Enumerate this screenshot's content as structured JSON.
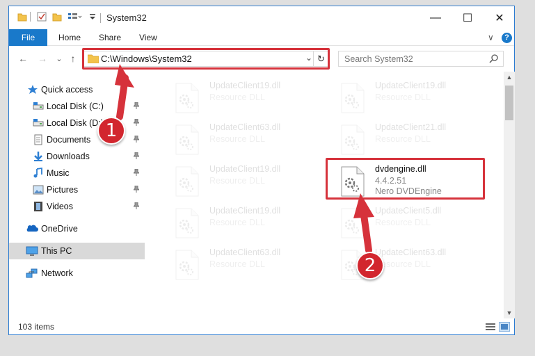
{
  "window": {
    "title": "System32",
    "minimize_glyph": "—",
    "maximize_glyph": "☐",
    "close_glyph": "✕"
  },
  "ribbon": {
    "tabs": [
      "File",
      "Home",
      "Share",
      "View"
    ],
    "expand_glyph": "∨",
    "help_glyph": "?"
  },
  "nav": {
    "back_glyph": "←",
    "forward_glyph": "→",
    "recent_glyph": "⌄",
    "up_glyph": "↑",
    "address": "C:\\Windows\\System32",
    "address_dropdown_glyph": "⌄",
    "refresh_glyph": "↻",
    "search_placeholder": "Search System32"
  },
  "sidebar": {
    "items": [
      {
        "label": "Quick access",
        "icon": "star-icon",
        "pinned": false
      },
      {
        "label": "Local Disk (C:)",
        "icon": "drive-icon",
        "pinned": true
      },
      {
        "label": "Local Disk (D:)",
        "icon": "drive-icon",
        "pinned": true
      },
      {
        "label": "Documents",
        "icon": "documents-icon",
        "pinned": true
      },
      {
        "label": "Downloads",
        "icon": "downloads-icon",
        "pinned": true
      },
      {
        "label": "Music",
        "icon": "music-icon",
        "pinned": true
      },
      {
        "label": "Pictures",
        "icon": "pictures-icon",
        "pinned": true
      },
      {
        "label": "Videos",
        "icon": "videos-icon",
        "pinned": true
      },
      {
        "label": "OneDrive",
        "icon": "onedrive-icon",
        "pinned": false
      },
      {
        "label": "This PC",
        "icon": "pc-icon",
        "pinned": false,
        "selected": true
      },
      {
        "label": "Network",
        "icon": "network-icon",
        "pinned": false
      }
    ],
    "pin_glyph": "📌"
  },
  "files": [
    {
      "name": "UpdateClient19.dll",
      "desc": "Resource DLL"
    },
    {
      "name": "UpdateClient19.dll",
      "desc": "Resource DLL"
    },
    {
      "name": "UpdateClient63.dll",
      "desc": "Resource DLL"
    },
    {
      "name": "UpdateClient21.dll",
      "desc": "Resource DLL"
    },
    {
      "name": "UpdateClient19.dll",
      "desc": "Resource DLL"
    },
    {
      "name": "dvdengine.dll",
      "desc": "4.4.2.51",
      "sub": "Nero DVDEngine",
      "highlighted": true
    },
    {
      "name": "UpdateClient19.dll",
      "desc": "Resource DLL"
    },
    {
      "name": "UpdateClient5.dll",
      "desc": "Resource DLL"
    },
    {
      "name": "UpdateClient63.dll",
      "desc": "Resource DLL"
    },
    {
      "name": "UpdateClient63.dll",
      "desc": "Resource DLL"
    }
  ],
  "status": {
    "item_count": "103 items"
  },
  "annotations": [
    {
      "number": "1"
    },
    {
      "number": "2"
    }
  ],
  "colors": {
    "accent": "#1979ca",
    "annotation_red": "#d6323b"
  }
}
